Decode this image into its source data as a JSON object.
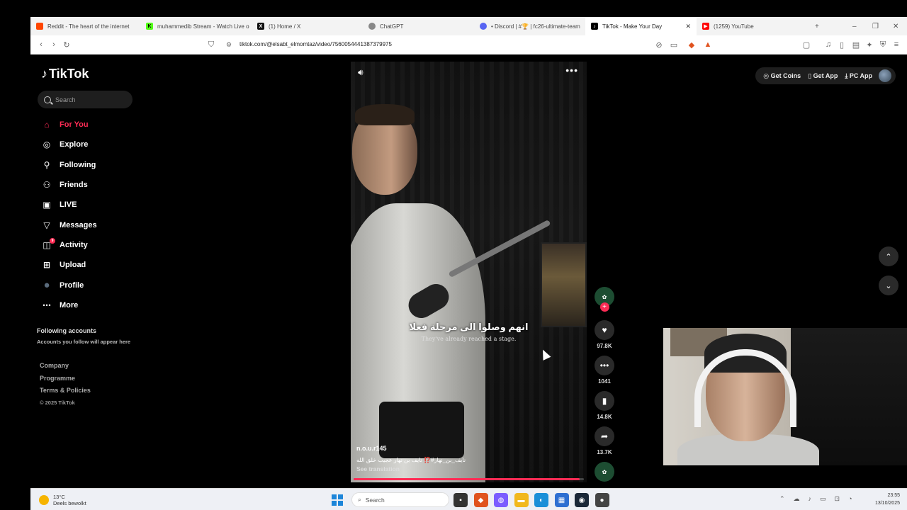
{
  "browser": {
    "tabs": [
      {
        "label": "Reddit - The heart of the internet",
        "icon_color": "#ff4500",
        "icon": "reddit-icon"
      },
      {
        "label": "muhammedib Stream - Watch Live o",
        "icon_color": "#53fc18",
        "icon": "kick-icon"
      },
      {
        "label": "(1) Home / X",
        "icon_color": "#111111",
        "icon": "x-icon"
      },
      {
        "label": "ChatGPT",
        "icon_color": "#888888",
        "icon": "chatgpt-icon"
      },
      {
        "label": "• Discord | #🏆 | fc26-ultimate-team",
        "icon_color": "#5865f2",
        "icon": "discord-icon"
      },
      {
        "label": "TikTok - Make Your Day",
        "icon_color": "#000000",
        "icon": "tiktok-icon",
        "active": true
      },
      {
        "label": "(1259) YouTube",
        "icon_color": "#ff0000",
        "icon": "youtube-icon"
      }
    ],
    "url": "tiktok.com/@elsabt_elmomtaz/video/7560054441387379975"
  },
  "tiktok": {
    "logo": "TikTok",
    "search_placeholder": "Search",
    "nav": [
      {
        "label": "For You",
        "icon": "home-icon",
        "glyph": "⌂",
        "active": true
      },
      {
        "label": "Explore",
        "icon": "compass-icon",
        "glyph": "◎"
      },
      {
        "label": "Following",
        "icon": "following-icon",
        "glyph": "⚲"
      },
      {
        "label": "Friends",
        "icon": "friends-icon",
        "glyph": "⚇"
      },
      {
        "label": "LIVE",
        "icon": "live-icon",
        "glyph": "▣"
      },
      {
        "label": "Messages",
        "icon": "messages-icon",
        "glyph": "▽"
      },
      {
        "label": "Activity",
        "icon": "activity-icon",
        "glyph": "◫",
        "badge": "9"
      },
      {
        "label": "Upload",
        "icon": "upload-icon",
        "glyph": "⊞"
      },
      {
        "label": "Profile",
        "icon": "profile-avatar-icon",
        "glyph": "●"
      },
      {
        "label": "More",
        "icon": "more-icon",
        "glyph": "⋯"
      }
    ],
    "following_title": "Following accounts",
    "following_sub": "Accounts you follow will appear here",
    "footer": [
      "Company",
      "Programme",
      "Terms & Policies"
    ],
    "copyright": "© 2025 TikTok",
    "top_actions": {
      "coins": "Get Coins",
      "app": "Get App",
      "pc": "PC App"
    },
    "video": {
      "subtitle_ar": "انهم وصلوا الى مرحلة فعلا",
      "subtitle_en": "They've already reached a stage.",
      "author": "n.o.u.r145",
      "caption": "نايف_بن_نهار#⁉️ نايف بن نهار عجيب خلق الله",
      "see_translation": "See translation",
      "progress": 0.98
    },
    "stats": {
      "likes": "97.8K",
      "comments": "1041",
      "saves": "14.8K",
      "shares": "13.7K"
    }
  },
  "taskbar": {
    "temp": "13°C",
    "weather": "Deels bewolkt",
    "search": "Search",
    "time": "23:55",
    "date": "13/10/2025",
    "colors": {
      "start": "#1d86d9"
    }
  }
}
